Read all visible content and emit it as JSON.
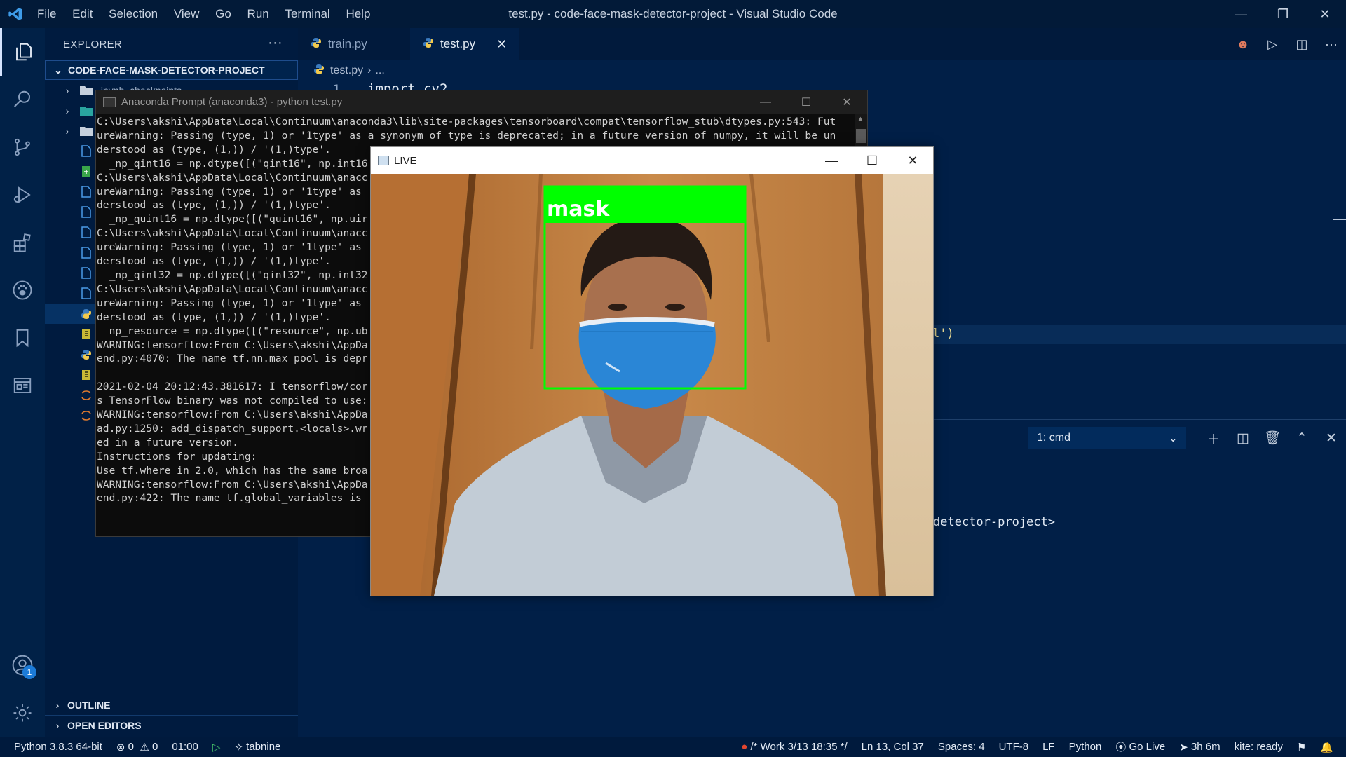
{
  "titlebar": {
    "menu": [
      "File",
      "Edit",
      "Selection",
      "View",
      "Go",
      "Run",
      "Terminal",
      "Help"
    ],
    "title": "test.py - code-face-mask-detector-project - Visual Studio Code"
  },
  "sidebar": {
    "header": "EXPLORER",
    "project": "CODE-FACE-MASK-DETECTOR-PROJECT",
    "first_folder_partial": ".ipynb_checkpoints",
    "outline": "OUTLINE",
    "open_editors": "OPEN EDITORS"
  },
  "accounts_badge": "1",
  "tabs": [
    {
      "label": "train.py"
    },
    {
      "label": "test.py"
    }
  ],
  "breadcrumb": {
    "file": "test.py",
    "rest": "..."
  },
  "editor": {
    "line1_number": "1",
    "line1_code": "import cv2",
    "visible_fragment": "l')"
  },
  "panel": {
    "terminal_select": "1: cmd",
    "prompt_fragment": "detector-project>"
  },
  "anaconda": {
    "title": "Anaconda Prompt (anaconda3) - python  test.py",
    "lines": [
      "C:\\Users\\akshi\\AppData\\Local\\Continuum\\anaconda3\\lib\\site-packages\\tensorboard\\compat\\tensorflow_stub\\dtypes.py:543: Fut",
      "ureWarning: Passing (type, 1) or '1type' as a synonym of type is deprecated; in a future version of numpy, it will be un",
      "derstood as (type, (1,)) / '(1,)type'.",
      "  _np_qint16 = np.dtype([(\"qint16\", np.int16",
      "C:\\Users\\akshi\\AppData\\Local\\Continuum\\anacc",
      "ureWarning: Passing (type, 1) or '1type' as",
      "derstood as (type, (1,)) / '(1,)type'.",
      "  _np_quint16 = np.dtype([(\"quint16\", np.uir",
      "C:\\Users\\akshi\\AppData\\Local\\Continuum\\anacc",
      "ureWarning: Passing (type, 1) or '1type' as",
      "derstood as (type, (1,)) / '(1,)type'.",
      "  _np_qint32 = np.dtype([(\"qint32\", np.int32",
      "C:\\Users\\akshi\\AppData\\Local\\Continuum\\anacc",
      "ureWarning: Passing (type, 1) or '1type' as",
      "derstood as (type, (1,)) / '(1,)type'.",
      "  np_resource = np.dtype([(\"resource\", np.ub",
      "WARNING:tensorflow:From C:\\Users\\akshi\\AppDa",
      "end.py:4070: The name tf.nn.max_pool is depr",
      "",
      "2021-02-04 20:12:43.381617: I tensorflow/cor",
      "s TensorFlow binary was not compiled to use:",
      "WARNING:tensorflow:From C:\\Users\\akshi\\AppDa",
      "ad.py:1250: add_dispatch_support.<locals>.wr",
      "ed in a future version.",
      "Instructions for updating:",
      "Use tf.where in 2.0, which has the same broa",
      "WARNING:tensorflow:From C:\\Users\\akshi\\AppDa",
      "end.py:422: The name tf.global_variables is"
    ]
  },
  "live": {
    "title": "LIVE",
    "detection_label": "mask",
    "detection_color": "#00ff00"
  },
  "statusbar": {
    "python": "Python 3.8.3 64-bit",
    "errors": "0",
    "warnings": "0",
    "time": "01:00",
    "tabnine": "tabnine",
    "work": "/* Work 3/13 18:35 */",
    "position": "Ln 13, Col 37",
    "spaces": "Spaces: 4",
    "encoding": "UTF-8",
    "eol": "LF",
    "language": "Python",
    "golive": "Go Live",
    "timer": "3h 6m",
    "kite": "kite: ready"
  }
}
